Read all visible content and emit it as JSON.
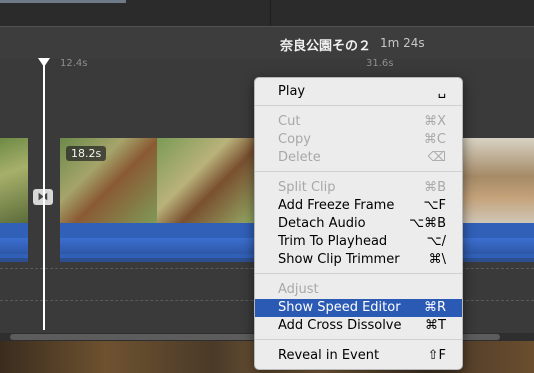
{
  "project": {
    "title": "奈良公園その２",
    "duration": "1m 24s"
  },
  "ruler": {
    "tick1": "12.4s",
    "tick2": "31.6s"
  },
  "clip": {
    "duration_badge": "18.2s"
  },
  "icons": {
    "transition": "transition-icon"
  },
  "context_menu": {
    "items": [
      {
        "label": "Play",
        "shortcut": "␣",
        "enabled": true
      },
      {
        "label": "Cut",
        "shortcut": "⌘X",
        "enabled": false
      },
      {
        "label": "Copy",
        "shortcut": "⌘C",
        "enabled": false
      },
      {
        "label": "Delete",
        "shortcut": "⌫",
        "enabled": false
      },
      {
        "label": "Split Clip",
        "shortcut": "⌘B",
        "enabled": false
      },
      {
        "label": "Add Freeze Frame",
        "shortcut": "⌥F",
        "enabled": true
      },
      {
        "label": "Detach Audio",
        "shortcut": "⌥⌘B",
        "enabled": true
      },
      {
        "label": "Trim To Playhead",
        "shortcut": "⌥/",
        "enabled": true
      },
      {
        "label": "Show Clip Trimmer",
        "shortcut": "⌘\\",
        "enabled": true
      },
      {
        "label": "Adjust",
        "shortcut": "",
        "enabled": false
      },
      {
        "label": "Show Speed Editor",
        "shortcut": "⌘R",
        "enabled": true,
        "highlighted": true
      },
      {
        "label": "Add Cross Dissolve",
        "shortcut": "⌘T",
        "enabled": true
      },
      {
        "label": "Reveal in Event",
        "shortcut": "⇧F",
        "enabled": true
      }
    ]
  },
  "colors": {
    "highlight": "#2b5ab5",
    "audio": "#3060b8",
    "menu_bg": "#ececec"
  }
}
